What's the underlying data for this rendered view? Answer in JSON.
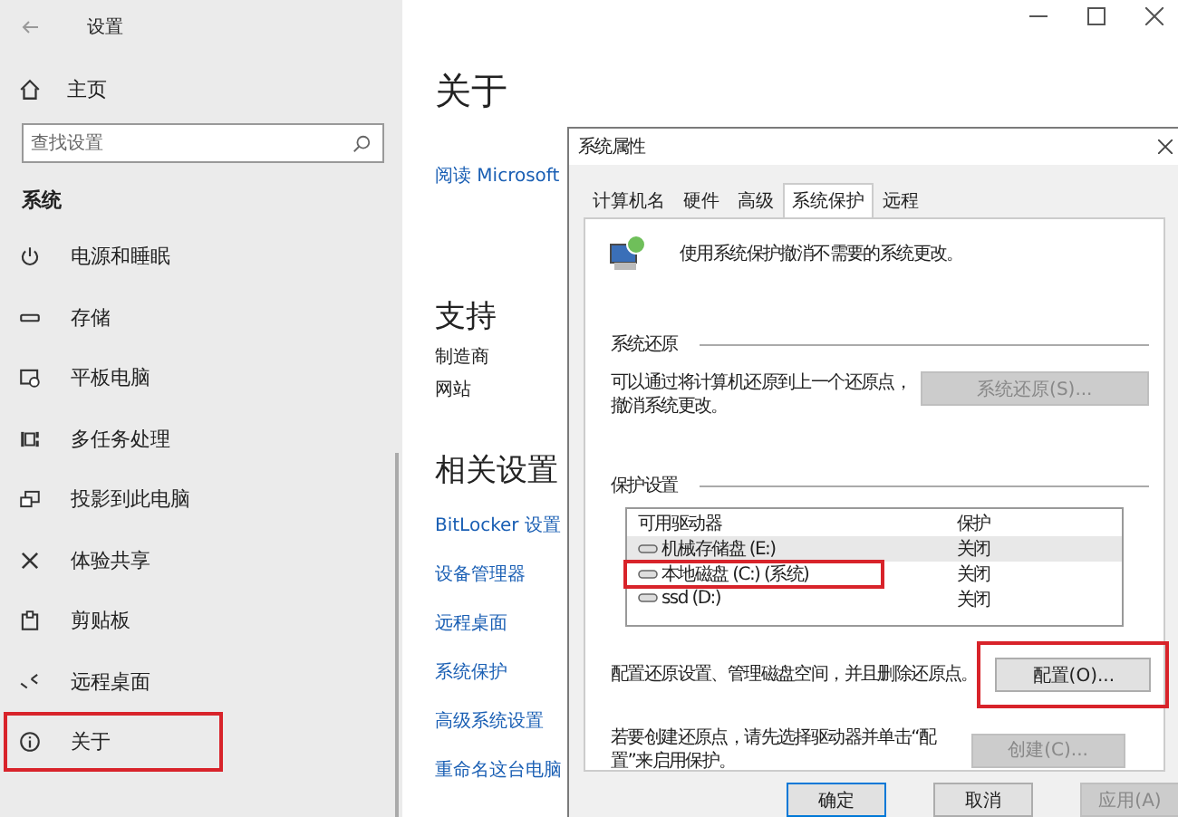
{
  "settings": {
    "title": "设置",
    "home": "主页",
    "search": {
      "placeholder": "查找设置"
    },
    "section": "系统",
    "nav": [
      {
        "label": "电源和睡眠",
        "annotated": false
      },
      {
        "label": "存储",
        "annotated": false
      },
      {
        "label": "平板电脑",
        "annotated": false
      },
      {
        "label": "多任务处理",
        "annotated": false
      },
      {
        "label": "投影到此电脑",
        "annotated": false
      },
      {
        "label": "体验共享",
        "annotated": false
      },
      {
        "label": "剪贴板",
        "annotated": false
      },
      {
        "label": "远程桌面",
        "annotated": false
      },
      {
        "label": "关于",
        "annotated": true
      }
    ]
  },
  "main": {
    "title": "关于",
    "link": "阅读 Microsoft",
    "support": {
      "heading": "支持",
      "items": [
        "制造商",
        "网站"
      ]
    },
    "related": {
      "heading": "相关设置",
      "links": [
        "BitLocker 设置",
        "设备管理器",
        "远程桌面",
        "系统保护",
        "高级系统设置",
        "重命名这台电脑"
      ]
    }
  },
  "dialog": {
    "title": "系统属性",
    "tabs": [
      {
        "label": "计算机名",
        "selected": false
      },
      {
        "label": "硬件",
        "selected": false
      },
      {
        "label": "高级",
        "selected": false
      },
      {
        "label": "系统保护",
        "selected": true
      },
      {
        "label": "远程",
        "selected": false
      }
    ],
    "intro": "使用系统保护撤消不需要的系统更改。",
    "restore": {
      "heading": "系统还原",
      "text": "可以通过将计算机还原到上一个还原点，撤消系统更改。",
      "button": {
        "label": "系统还原(S)...",
        "disabled": true
      }
    },
    "protection": {
      "heading": "保护设置",
      "columns": [
        "可用驱动器",
        "保护"
      ],
      "drives": [
        {
          "name": "机械存储盘 (E:)",
          "status": "关闭",
          "selected": true,
          "annotated": false
        },
        {
          "name": "本地磁盘 (C:) (系统)",
          "status": "关闭",
          "selected": false,
          "annotated": true
        },
        {
          "name": "ssd (D:)",
          "status": "关闭",
          "selected": false,
          "annotated": false
        }
      ]
    },
    "configure": {
      "text": "配置还原设置、管理磁盘空间，并且删除还原点。",
      "button": {
        "label": "配置(O)...",
        "disabled": false,
        "annotated": true
      }
    },
    "create": {
      "text": "若要创建还原点，请先选择驱动器并单击“配置”来启用保护。",
      "button": {
        "label": "创建(C)...",
        "disabled": true
      }
    },
    "buttons": [
      {
        "label": "确定",
        "disabled": false
      },
      {
        "label": "取消",
        "disabled": false
      },
      {
        "label": "应用(A)",
        "disabled": true
      }
    ]
  }
}
